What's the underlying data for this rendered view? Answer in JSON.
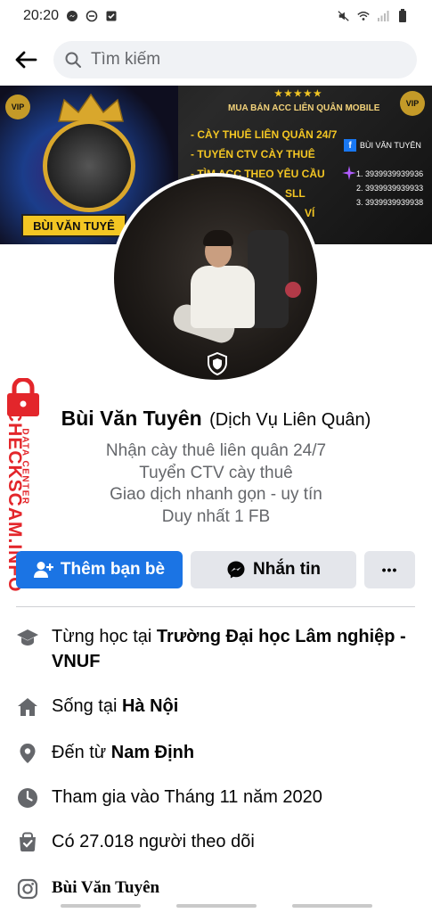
{
  "status_bar": {
    "time": "20:20",
    "left_icons": [
      "messenger-icon",
      "do-not-disturb-icon",
      "checkbox-notification-icon"
    ],
    "right_icons": [
      "mute-icon",
      "wifi-icon",
      "signal-icon",
      "battery-icon"
    ]
  },
  "search": {
    "placeholder": "Tìm kiếm"
  },
  "cover": {
    "stars": "★★★★★",
    "heading": "MUA BÁN ACC LIÊN QUÂN MOBILE",
    "services": [
      "- CÀY THUÊ LIÊN QUÂN 24/7",
      "- TUYỂN CTV CÀY THUÊ",
      "- TÌM ACC THEO YÊU CẦU",
      "SLL",
      "VÍ"
    ],
    "fb_name": "BÙI VĂN TUYÊN",
    "phones": [
      "1. 3939939939936",
      "2. 3939939939933",
      "3. 3939939939938"
    ],
    "name_banner": "BÙI VĂN TUYÊ",
    "vip": "VIP"
  },
  "watermark": {
    "main": "CHECKSCAM.INFO",
    "sub": "DATA CENTER"
  },
  "profile": {
    "name": "Bùi Văn Tuyên",
    "alt_name": "(Dịch Vụ Liên Quân)",
    "bio_lines": [
      "Nhận cày thuê liên quân 24/7",
      "Tuyển CTV cày thuê",
      "Giao dịch nhanh gọn - uy tín",
      "Duy nhất 1 FB"
    ]
  },
  "actions": {
    "add_friend": "Thêm bạn bè",
    "message": "Nhắn tin",
    "more": "•••"
  },
  "details": [
    {
      "icon": "graduation-cap-icon",
      "prefix": "Từng học tại ",
      "value": "Trường Đại học Lâm nghiệp - VNUF"
    },
    {
      "icon": "home-icon",
      "prefix": "Sống tại ",
      "value": "Hà Nội"
    },
    {
      "icon": "location-pin-icon",
      "prefix": "Đến từ ",
      "value": "Nam Định"
    },
    {
      "icon": "clock-icon",
      "prefix": "Tham gia vào Tháng 11 năm 2020",
      "value": ""
    },
    {
      "icon": "followers-icon",
      "prefix": "Có 27.018 người theo dõi",
      "value": ""
    },
    {
      "icon": "instagram-icon",
      "prefix": "",
      "value": "Bùi Văn Tuyên"
    }
  ]
}
